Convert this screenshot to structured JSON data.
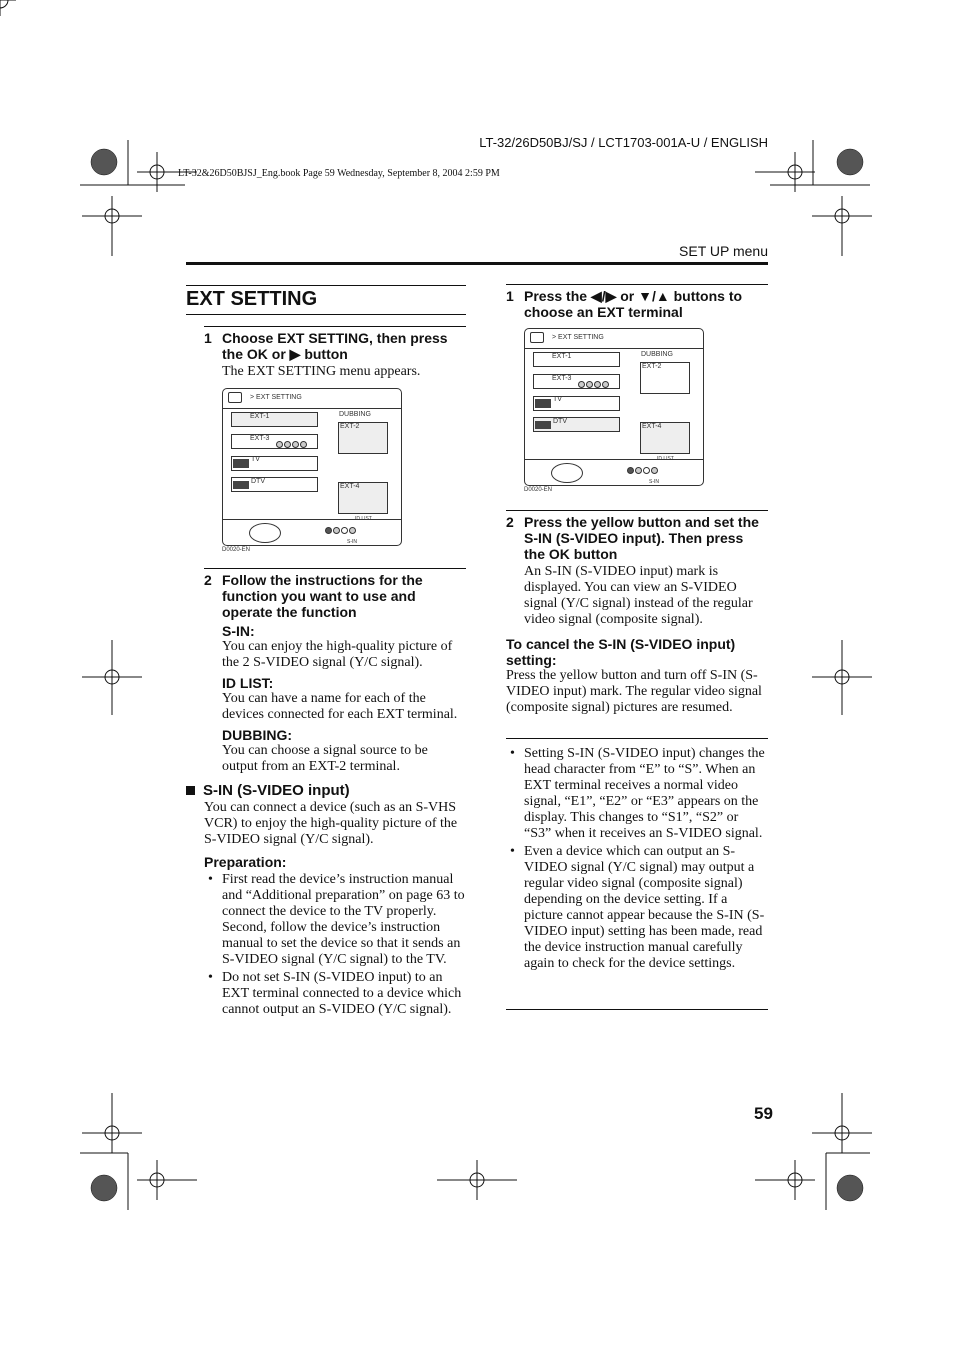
{
  "header": {
    "model": "LT-32/26D50BJ/SJ / LCT1703-001A-U / ENGLISH",
    "bookline": "LT-32&26D50BJSJ_Eng.book  Page 59  Wednesday, September 8, 2004  2:59 PM",
    "section": "SET UP menu"
  },
  "page_number": "59",
  "title": "EXT SETTING",
  "menu": {
    "crumb": "> EXT SETTING",
    "ext1": "EXT-1",
    "ext3": "EXT-3",
    "tv": "TV",
    "dtv": "DTV",
    "dubbing": "DUBBING",
    "ext2": "EXT-2",
    "ext4": "EXT-4",
    "idlist": "ID LIST",
    "sin": "S-IN",
    "code": "D0020-EN"
  },
  "left": {
    "step1": {
      "num": "1",
      "title": "Choose EXT SETTING, then press the OK or ▶ button",
      "text": "The EXT SETTING menu appears."
    },
    "step2": {
      "num": "2",
      "title": "Follow the instructions for the function you want to use and operate the function"
    },
    "terms": [
      {
        "term": "S-IN:",
        "desc": "You can enjoy the high-quality picture of the 2 S-VIDEO signal (Y/C signal)."
      },
      {
        "term": "ID LIST:",
        "desc": "You can have a name for each of the devices connected for each EXT terminal."
      },
      {
        "term": "DUBBING:",
        "desc": "You can choose a signal source to be output from an EXT-2 terminal."
      }
    ],
    "sin_heading": "S-IN (S-VIDEO input)",
    "sin_text": "You can connect a device (such as an S-VHS VCR) to enjoy the high-quality picture of the S-VIDEO signal (Y/C signal).",
    "prep_heading": "Preparation:",
    "prep_bullets": [
      "First read the device’s instruction manual and “Additional preparation” on page 63 to connect the device to the TV properly. Second, follow the device’s instruction manual to set the device so that it sends an S-VIDEO signal (Y/C signal) to the TV.",
      "Do not set S-IN (S-VIDEO input) to an EXT terminal connected to a device which cannot output an S-VIDEO (Y/C signal)."
    ]
  },
  "right": {
    "step1": {
      "num": "1",
      "title": "Press the ◀/▶ or ▼/▲ buttons to choose an EXT terminal"
    },
    "step2": {
      "num": "2",
      "title": "Press the yellow button and set the S-IN (S-VIDEO input). Then press the OK button",
      "text": "An S-IN (S-VIDEO input) mark is displayed. You can view an S-VIDEO signal (Y/C signal) instead of the regular video signal (composite signal)."
    },
    "cancel_heading": "To cancel the S-IN (S-VIDEO input) setting:",
    "cancel_text": "Press the yellow button and turn off S-IN (S-VIDEO input) mark. The regular video signal (composite signal) pictures are resumed.",
    "notes": [
      "Setting S-IN (S-VIDEO input) changes the head character from “E” to “S”. When an EXT terminal receives a normal video signal, “E1”, “E2” or “E3” appears on the display. This changes to “S1”, “S2” or “S3” when it receives an S-VIDEO signal.",
      "Even a device which can output an S-VIDEO signal (Y/C signal) may output a regular video signal (composite signal) depending on the device setting. If a picture cannot appear because the S-IN (S-VIDEO input) setting has been made, read the device instruction manual carefully again to check for the device settings."
    ]
  }
}
